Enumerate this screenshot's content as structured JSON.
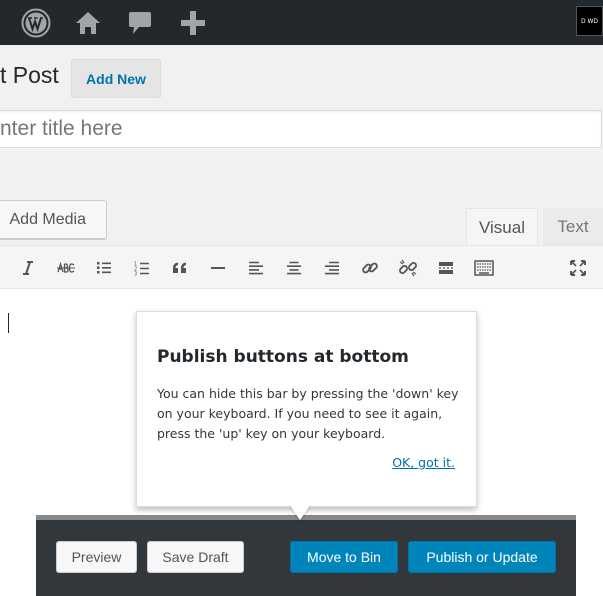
{
  "adminbar": {
    "icons": [
      "wordpress-logo-icon",
      "home-icon",
      "comment-icon",
      "plus-icon"
    ],
    "avatar_text": "D WD"
  },
  "heading": {
    "title": "t Post",
    "add_new_label": "Add New"
  },
  "title_field": {
    "placeholder": "nter title here"
  },
  "editor": {
    "add_media_label": "Add Media",
    "tabs": [
      {
        "label": "Visual",
        "active": true
      },
      {
        "label": "Text",
        "active": false
      }
    ],
    "toolbar_icons": [
      "italic-icon",
      "strikethrough-icon",
      "bullet-list-icon",
      "numbered-list-icon",
      "blockquote-icon",
      "horizontal-rule-icon",
      "align-left-icon",
      "align-center-icon",
      "align-right-icon",
      "link-icon",
      "unlink-icon",
      "read-more-icon",
      "toolbar-toggle-icon",
      "fullscreen-icon"
    ]
  },
  "popover": {
    "title": "Publish buttons at bottom",
    "body": "You can hide this bar by pressing the 'down' key on your keyboard. If you need to see it again, press the 'up' key on your keyboard.",
    "dismiss_label": "OK, got it."
  },
  "publish_bar": {
    "preview_label": "Preview",
    "save_draft_label": "Save Draft",
    "move_to_bin_label": "Move to Bin",
    "publish_label": "Publish or Update"
  },
  "colors": {
    "adminbar_bg": "#23282d",
    "primary_button": "#0085ba",
    "link": "#0073aa",
    "publish_bar_bg": "#32373c"
  }
}
